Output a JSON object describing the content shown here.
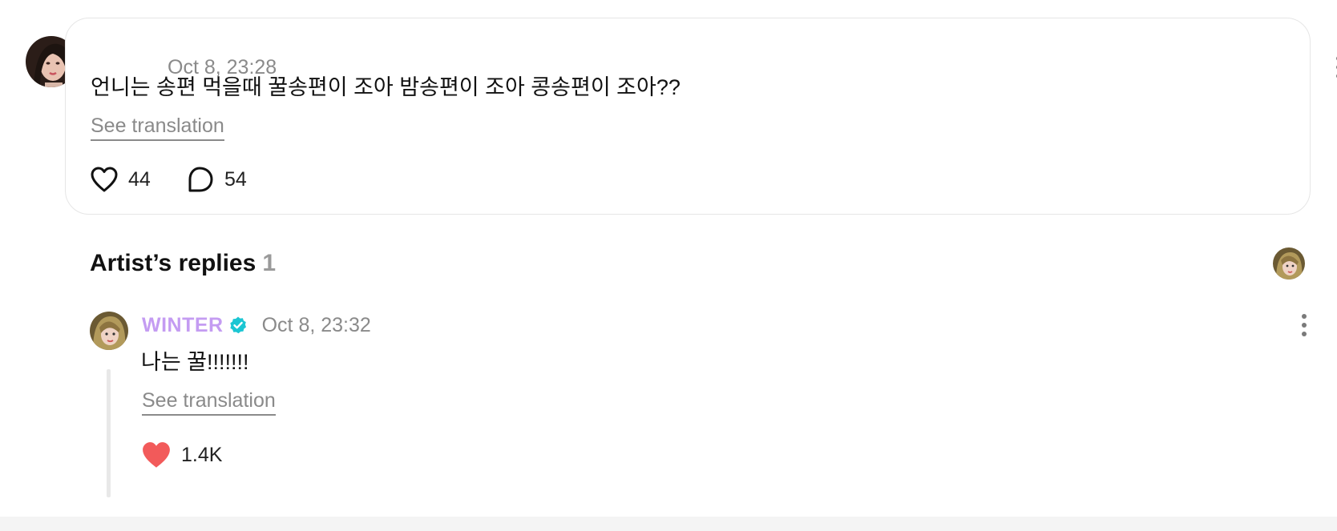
{
  "post": {
    "timestamp": "Oct 8, 23:28",
    "text": "언니는 송편 먹을때 꿀송편이 조아 밤송편이 조아 콩송편이 조아??",
    "see_translation": "See translation",
    "like_count": "44",
    "reply_count": "54",
    "icons": {
      "avatar": "fan-avatar",
      "more": "more-vertical-icon",
      "like": "heart-outline-icon",
      "reply": "speech-bubble-icon"
    }
  },
  "artist_replies": {
    "heading": "Artist’s replies",
    "count": "1",
    "replies": [
      {
        "author": "WINTER",
        "author_color": "#c49cf2",
        "verified_color": "#1cc6d3",
        "timestamp": "Oct 8, 23:32",
        "text": "나는 꿀!!!!!!!",
        "see_translation": "See translation",
        "like_count": "1.4K",
        "like_color": "#f25a5a"
      }
    ]
  }
}
